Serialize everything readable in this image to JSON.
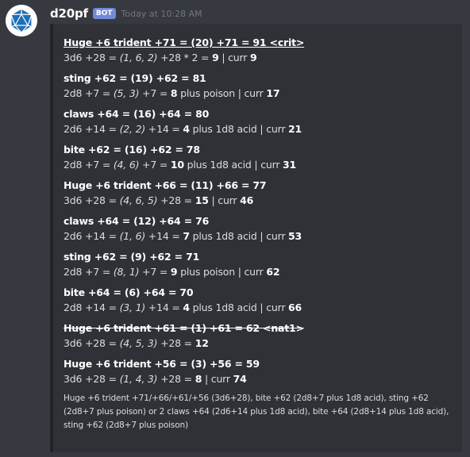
{
  "message": {
    "username": "d20pf",
    "bot_tag": "BOT",
    "timestamp": "Today at 10:28 AM"
  },
  "rolls": [
    {
      "title": "Huge +6 trident +71 = (20) +71 = 91 <crit>",
      "style": "underline",
      "dice": "3d6 +28 = ",
      "values": "(1, 6, 2)",
      "mid": " +28 * 2 = ",
      "result": "9",
      "extra": " | curr ",
      "curr": "9"
    },
    {
      "title": "sting +62 = (19) +62 = 81",
      "style": "",
      "dice": "2d8 +7 = ",
      "values": "(5, 3)",
      "mid": " +7 = ",
      "result": "8",
      "extra": " plus poison | curr ",
      "curr": "17"
    },
    {
      "title": "claws +64 = (16) +64 = 80",
      "style": "",
      "dice": "2d6 +14 = ",
      "values": "(2, 2)",
      "mid": " +14 = ",
      "result": "4",
      "extra": " plus 1d8 acid | curr ",
      "curr": "21"
    },
    {
      "title": "bite +62 = (16) +62 = 78",
      "style": "",
      "dice": "2d8 +7 = ",
      "values": "(4, 6)",
      "mid": " +7 = ",
      "result": "10",
      "extra": " plus 1d8 acid | curr ",
      "curr": "31"
    },
    {
      "title": "Huge +6 trident +66 = (11) +66 = 77",
      "style": "",
      "dice": "3d6 +28 = ",
      "values": "(4, 6, 5)",
      "mid": " +28 = ",
      "result": "15",
      "extra": " | curr ",
      "curr": "46"
    },
    {
      "title": "claws +64 = (12) +64 = 76",
      "style": "",
      "dice": "2d6 +14 = ",
      "values": "(1, 6)",
      "mid": " +14 = ",
      "result": "7",
      "extra": " plus 1d8 acid | curr ",
      "curr": "53"
    },
    {
      "title": "sting +62 = (9) +62 = 71",
      "style": "",
      "dice": "2d8 +7 = ",
      "values": "(8, 1)",
      "mid": " +7 = ",
      "result": "9",
      "extra": " plus poison | curr ",
      "curr": "62"
    },
    {
      "title": "bite +64 = (6) +64 = 70",
      "style": "",
      "dice": "2d8 +14 = ",
      "values": "(3, 1)",
      "mid": " +14 = ",
      "result": "4",
      "extra": " plus 1d8 acid | curr ",
      "curr": "66"
    },
    {
      "title": "Huge +6 trident +61 = (1) +61 = 62 <nat1>",
      "style": "strike",
      "dice": "3d6 +28 = ",
      "values": "(4, 5, 3)",
      "mid": " +28 = ",
      "result": "12",
      "extra": "",
      "curr": ""
    },
    {
      "title": "Huge +6 trident +56 = (3) +56 = 59",
      "style": "",
      "dice": "3d6 +28 = ",
      "values": "(1, 4, 3)",
      "mid": " +28 = ",
      "result": "8",
      "extra": " | curr ",
      "curr": "74"
    }
  ],
  "summary": "Huge +6 trident +71/+66/+61/+56 (3d6+28), bite +62 (2d8+7 plus 1d8 acid), sting +62 (2d8+7 plus poison) or 2 claws +64 (2d6+14 plus 1d8 acid), bite +64 (2d8+14 plus 1d8 acid), sting +62 (2d8+7 plus poison)",
  "icons": {
    "avatar": "d20-icon"
  },
  "colors": {
    "background": "#36393f",
    "embed": "#2f3136",
    "bot_tag": "#7289da"
  }
}
